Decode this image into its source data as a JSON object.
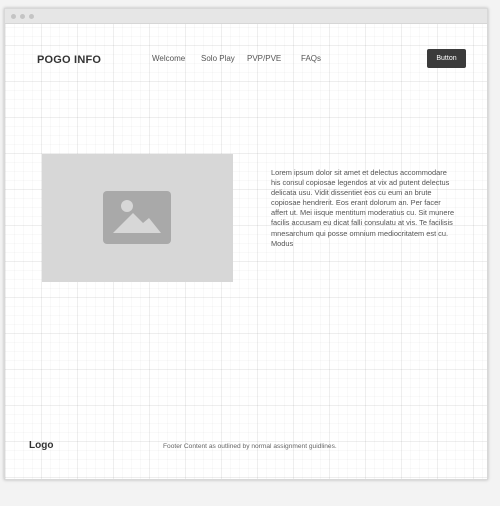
{
  "header": {
    "brand": "POGO INFO",
    "nav": [
      "Welcome",
      "Solo Play",
      "PVP/PVE",
      "FAQs"
    ],
    "button_label": "Button"
  },
  "hero": {
    "image_icon": "image-placeholder-icon",
    "text": "Lorem ipsum dolor sit amet et delectus accommodare his consul copiosae legendos at vix ad putent delectus delicata usu. Vidit dissentiet eos cu eum an brute copiosae hendrerit. Eos erant dolorum an. Per facer affert ut. Mei iisque mentitum moderatius cu. Sit munere facilis accusam eu dicat falli consulatu at vis. Te facilisis mnesarchum qui posse omnium mediocritatem est cu. Modus"
  },
  "footer": {
    "logo": "Logo",
    "text": "Footer Content as outlined by normal assignment guidlines."
  },
  "colors": {
    "button_bg": "#3b3b3b",
    "image_bg": "#d7d7d7",
    "icon_fill": "#a9a9a9"
  }
}
